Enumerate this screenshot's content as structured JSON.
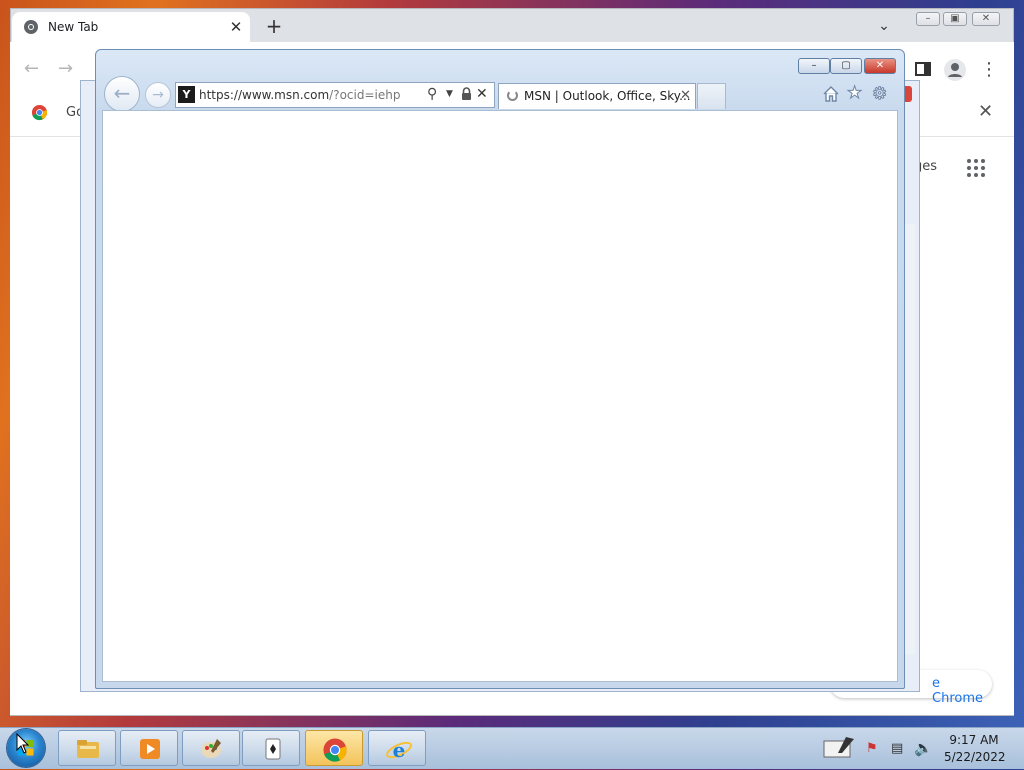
{
  "chrome": {
    "tab_title": "New Tab",
    "new_tab_label": "+",
    "bookmark_partial": "Go",
    "apps_partial": "ges",
    "customize_partial": "e Chrome"
  },
  "ie": {
    "address_url": "https://www.msn.com/?ocid=iehp",
    "url_host": "https://www.msn.com",
    "url_rest": "/?ocid=iehp",
    "tab_title": "MSN | Outlook, Office, Sky..."
  },
  "taskbar": {
    "pinned": [
      "file-explorer",
      "media-player",
      "paint",
      "solitaire",
      "chrome",
      "internet-explorer"
    ],
    "active": "chrome",
    "time": "9:17 AM",
    "date": "5/22/2022"
  },
  "colors": {
    "ie_frame": "#c9daee",
    "ie_close": "#c8382a",
    "chrome_frame": "#dee1e6",
    "link_blue": "#1a73e8",
    "taskbar": "#b8cce3"
  }
}
